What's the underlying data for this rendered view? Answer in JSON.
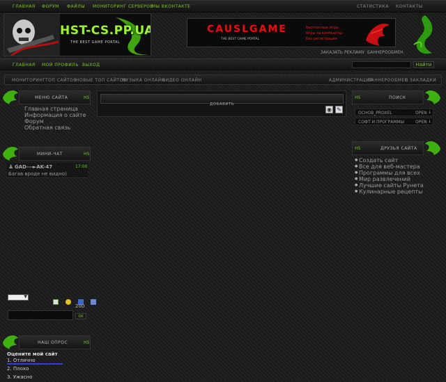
{
  "top_nav": {
    "left": [
      "Главная",
      "Форум",
      "Файлы",
      "Мониторинг серверов",
      "Мы ВКонтакте"
    ],
    "right": [
      "Статистика",
      "Контакты"
    ]
  },
  "logo": {
    "text": "HST-CS.PP.UA",
    "tagline": "THE BEST GAME PORTAL"
  },
  "banner": {
    "title": "CAUSLGAME",
    "tagline": "THE BEST GAME PORTAL",
    "items": [
      "Бесплатные игры",
      "Игры на компьютер",
      "Без регистрации"
    ]
  },
  "under_banner": [
    "Заказать рекламу",
    "Баннерообмен"
  ],
  "user_nav": [
    "Главная",
    "Мой профиль",
    "Выход"
  ],
  "search_top": {
    "value": "",
    "button": "Найти"
  },
  "sub_nav": {
    "left": [
      "Мониторинг",
      "Топ сайтов",
      "Новые топ сайтов",
      "Музыка онлайн",
      "Видео онлайн"
    ],
    "right": [
      "Администрация",
      "Баннерообмен",
      "В закладки"
    ]
  },
  "menu_panel": {
    "title": "Меню сайта",
    "hs": "HS",
    "links": [
      "Главная страница",
      "Информация о сайте",
      "Форум",
      "Обратная связь"
    ]
  },
  "chat_panel": {
    "title": "Мини-чат",
    "hs": "HS",
    "user": "GAD---►AK-47",
    "time": "17:00",
    "message": "Багав вроде не видно)",
    "counter": "200",
    "ok": "ok"
  },
  "poll_panel": {
    "title": "Наш опрос",
    "hs": "HS",
    "question": "Оцените мой сайт",
    "options": [
      "1. Отлично",
      "2. Плохо",
      "3. Ужасно"
    ],
    "first_share": 1.0
  },
  "center": {
    "add_label": "Добавить"
  },
  "search_panel": {
    "title": "Поиск",
    "hs": "HS",
    "rows": [
      {
        "label": "Основ_proxel",
        "state": "Open"
      },
      {
        "label": "Софт и программы",
        "state": "Open"
      }
    ]
  },
  "friends_panel": {
    "title": "Друзья сайта",
    "hs": "HS",
    "links": [
      "Создать сайт",
      "Все для веб-мастера",
      "Программы для всех",
      "Мир развлечений",
      "Лучшие сайты Рунета",
      "Кулинарные рецепты"
    ]
  },
  "colors": {
    "accent": "#5fd21c",
    "banner_red": "#e01010",
    "poll_bar": "#2f3fd8"
  }
}
